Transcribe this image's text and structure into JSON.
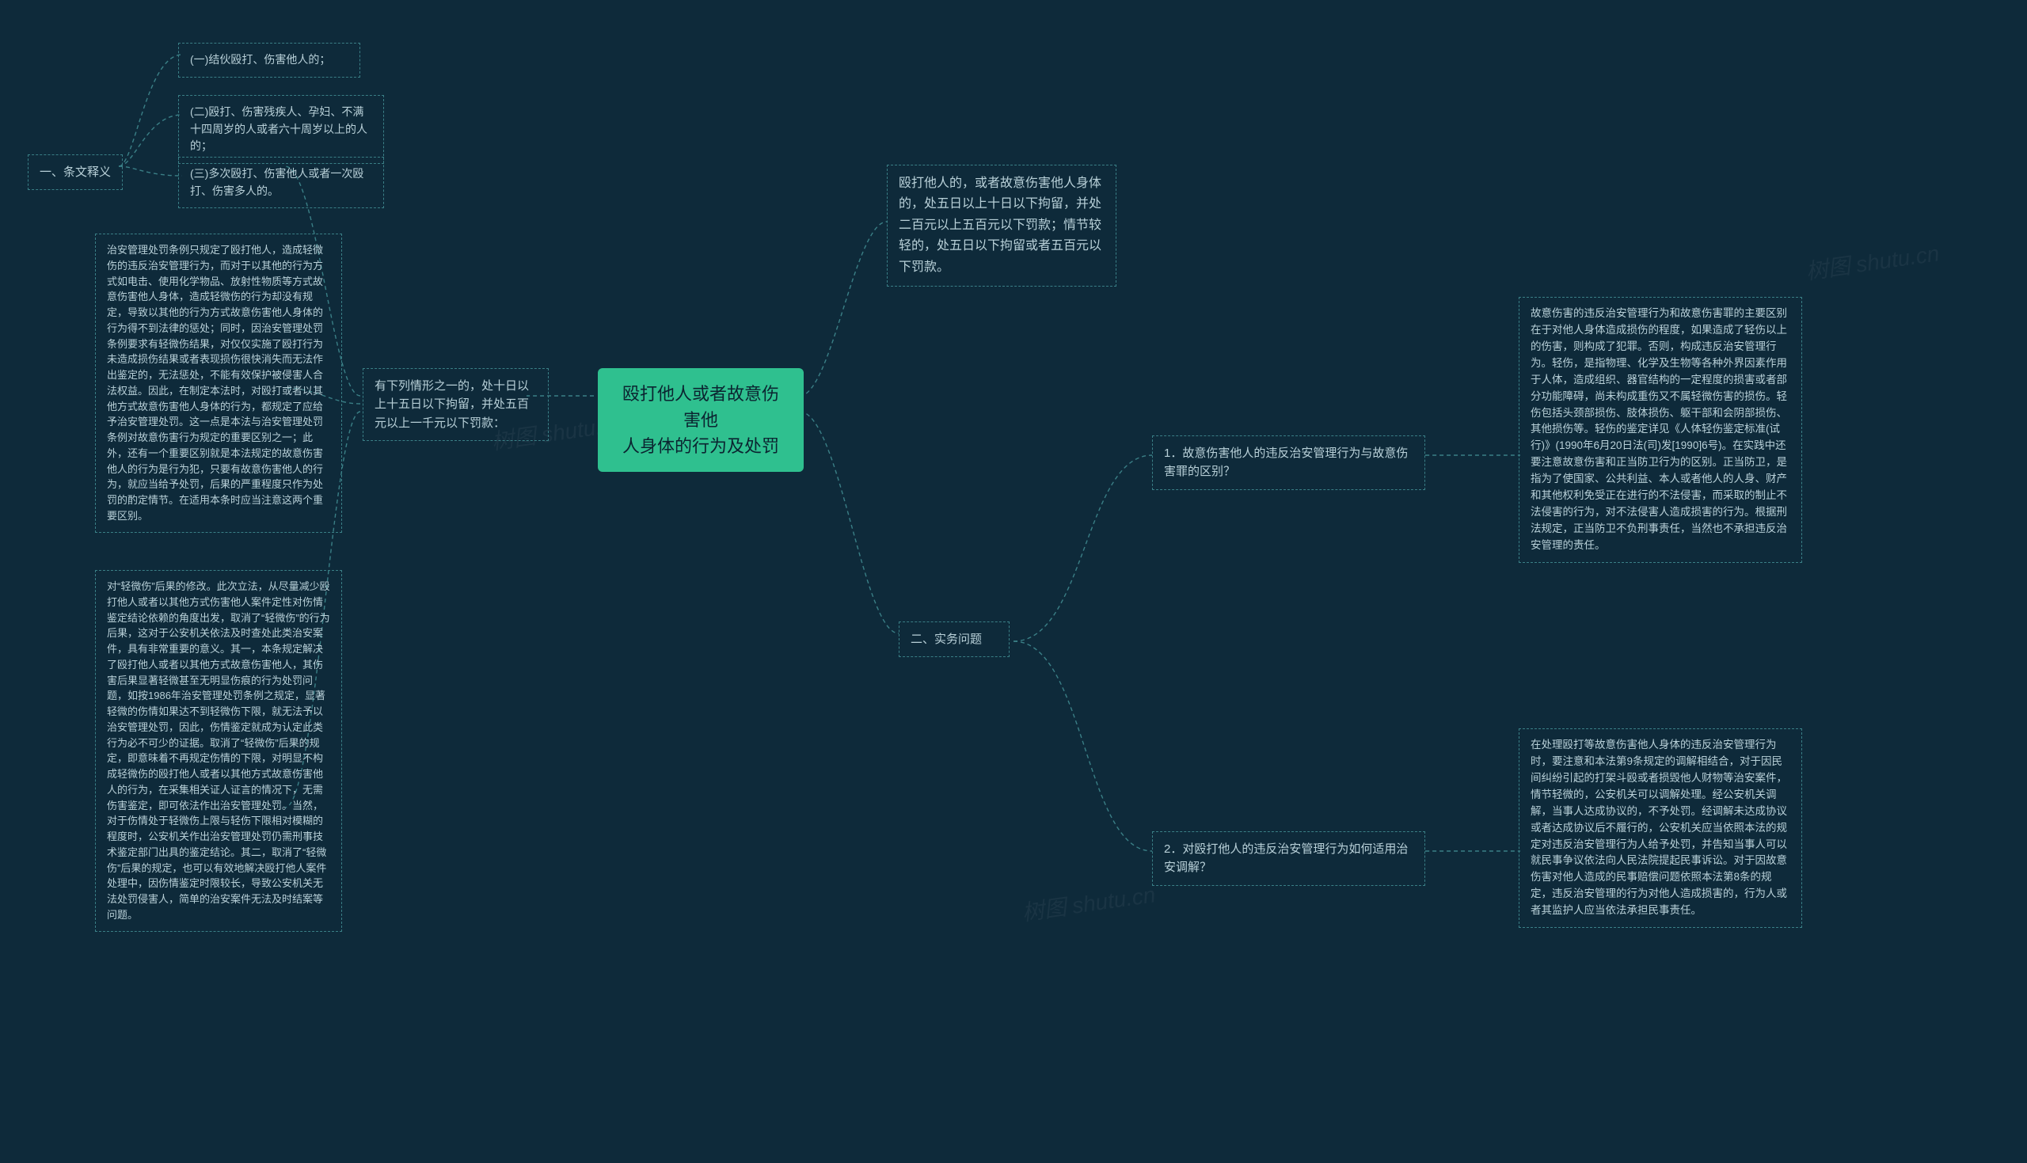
{
  "root": {
    "title_line1": "殴打他人或者故意伤害他",
    "title_line2": "人身体的行为及处罚"
  },
  "left": {
    "l1": "有下列情形之一的，处十日以上十五日以下拘留，并处五百元以上一千元以下罚款：",
    "interp_label": "一、条文释义",
    "item1": "(一)结伙殴打、伤害他人的；",
    "item2": "(二)殴打、伤害残疾人、孕妇、不满十四周岁的人或者六十周岁以上的人的；",
    "item3": "(三)多次殴打、伤害他人或者一次殴打、伤害多人的。",
    "para1": "治安管理处罚条例只规定了殴打他人，造成轻微伤的违反治安管理行为，而对于以其他的行为方式如电击、使用化学物品、放射性物质等方式故意伤害他人身体，造成轻微伤的行为却没有规定，导致以其他的行为方式故意伤害他人身体的行为得不到法律的惩处；同时，因治安管理处罚条例要求有轻微伤结果，对仅仅实施了殴打行为未造成损伤结果或者表现损伤很快消失而无法作出鉴定的，无法惩处，不能有效保护被侵害人合法权益。因此，在制定本法时，对殴打或者以其他方式故意伤害他人身体的行为，都规定了应给予治安管理处罚。这一点是本法与治安管理处罚条例对故意伤害行为规定的重要区别之一；此外，还有一个重要区别就是本法规定的故意伤害他人的行为是行为犯，只要有故意伤害他人的行为，就应当给予处罚，后果的严重程度只作为处罚的酌定情节。在适用本条时应当注意这两个重要区别。",
    "para2": "对“轻微伤”后果的修改。此次立法，从尽量减少殴打他人或者以其他方式伤害他人案件定性对伤情鉴定结论依赖的角度出发，取消了“轻微伤”的行为后果，这对于公安机关依法及时查处此类治安案件，具有非常重要的意义。其一，本条规定解决了殴打他人或者以其他方式故意伤害他人，其伤害后果显著轻微甚至无明显伤痕的行为处罚问题，如按1986年治安管理处罚条例之规定，显著轻微的伤情如果达不到轻微伤下限，就无法予以治安管理处罚，因此，伤情鉴定就成为认定此类行为必不可少的证据。取消了“轻微伤”后果的规定，即意味着不再规定伤情的下限，对明显不构成轻微伤的殴打他人或者以其他方式故意伤害他人的行为，在采集相关证人证言的情况下，无需伤害鉴定，即可依法作出治安管理处罚。当然，对于伤情处于轻微伤上限与轻伤下限相对模糊的程度时，公安机关作出治安管理处罚仍需刑事技术鉴定部门出具的鉴定结论。其二，取消了“轻微伤”后果的规定，也可以有效地解决殴打他人案件处理中，因伤情鉴定时限较长，导致公安机关无法处罚侵害人，简单的治安案件无法及时结案等问题。"
  },
  "right": {
    "r1": "殴打他人的，或者故意伤害他人身体的，处五日以上十日以下拘留，并处二百元以上五百元以下罚款；情节较轻的，处五日以下拘留或者五百元以下罚款。",
    "practice_label": "二、实务问题",
    "q1_label": "1．故意伤害他人的违反治安管理行为与故意伤害罪的区别？",
    "q1_text": "故意伤害的违反治安管理行为和故意伤害罪的主要区别在于对他人身体造成损伤的程度，如果造成了轻伤以上的伤害，则构成了犯罪。否则，构成违反治安管理行为。轻伤，是指物理、化学及生物等各种外界因素作用于人体，造成组织、器官结构的一定程度的损害或者部分功能障碍，尚未构成重伤又不属轻微伤害的损伤。轻伤包括头颈部损伤、肢体损伤、躯干部和会阴部损伤、其他损伤等。轻伤的鉴定详见《人体轻伤鉴定标准(试行)》(1990年6月20日法(司)发[1990]6号)。在实践中还要注意故意伤害和正当防卫行为的区别。正当防卫，是指为了使国家、公共利益、本人或者他人的人身、财产和其他权利免受正在进行的不法侵害，而采取的制止不法侵害的行为，对不法侵害人造成损害的行为。根据刑法规定，正当防卫不负刑事责任，当然也不承担违反治安管理的责任。",
    "q2_label": "2．对殴打他人的违反治安管理行为如何适用治安调解？",
    "q2_text": "在处理殴打等故意伤害他人身体的违反治安管理行为时，要注意和本法第9条规定的调解相结合，对于因民间纠纷引起的打架斗殴或者损毁他人财物等治安案件，情节轻微的，公安机关可以调解处理。经公安机关调解，当事人达成协议的，不予处罚。经调解未达成协议或者达成协议后不履行的，公安机关应当依照本法的规定对违反治安管理行为人给予处罚，并告知当事人可以就民事争议依法向人民法院提起民事诉讼。对于因故意伤害对他人造成的民事赔偿问题依照本法第8条的规定，违反治安管理的行为对他人造成损害的，行为人或者其监护人应当依法承担民事责任。"
  },
  "watermark_text": "树图 shutu.cn"
}
